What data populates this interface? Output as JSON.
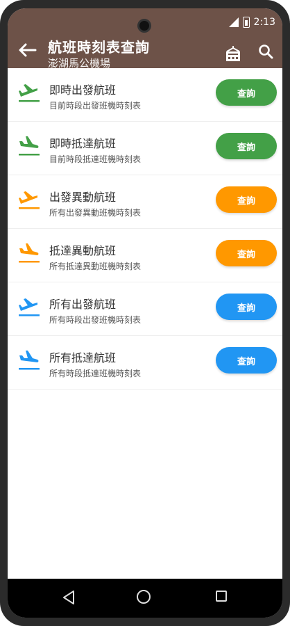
{
  "app": {
    "title": "航班時刻表查詢",
    "subtitle": "澎湖馬公機場",
    "time": "2:13",
    "colors": {
      "appbar": "#6d5248",
      "green": "#43a047",
      "orange": "#ff9800",
      "blue": "#2196f3"
    },
    "icons": {
      "back": "arrow-left-icon",
      "hotel": "hotel-icon",
      "search": "search-icon"
    }
  },
  "items": [
    {
      "title": "即時出發航班",
      "subtitle": "目前時段出發班機時刻表",
      "button": "查詢",
      "color": "green",
      "icon": "plane-departure-icon"
    },
    {
      "title": "即時抵達航班",
      "subtitle": "目前時段抵達班機時刻表",
      "button": "查詢",
      "color": "green",
      "icon": "plane-arrival-icon"
    },
    {
      "title": "出發異動航班",
      "subtitle": "所有出發異動班機時刻表",
      "button": "查詢",
      "color": "orange",
      "icon": "plane-departure-icon"
    },
    {
      "title": "抵達異動航班",
      "subtitle": "所有抵達異動班機時刻表",
      "button": "查詢",
      "color": "orange",
      "icon": "plane-arrival-icon"
    },
    {
      "title": "所有出發航班",
      "subtitle": "所有時段出發班機時刻表",
      "button": "查詢",
      "color": "blue",
      "icon": "plane-departure-icon"
    },
    {
      "title": "所有抵達航班",
      "subtitle": "所有時段抵達班機時刻表",
      "button": "查詢",
      "color": "blue",
      "icon": "plane-arrival-icon"
    }
  ]
}
